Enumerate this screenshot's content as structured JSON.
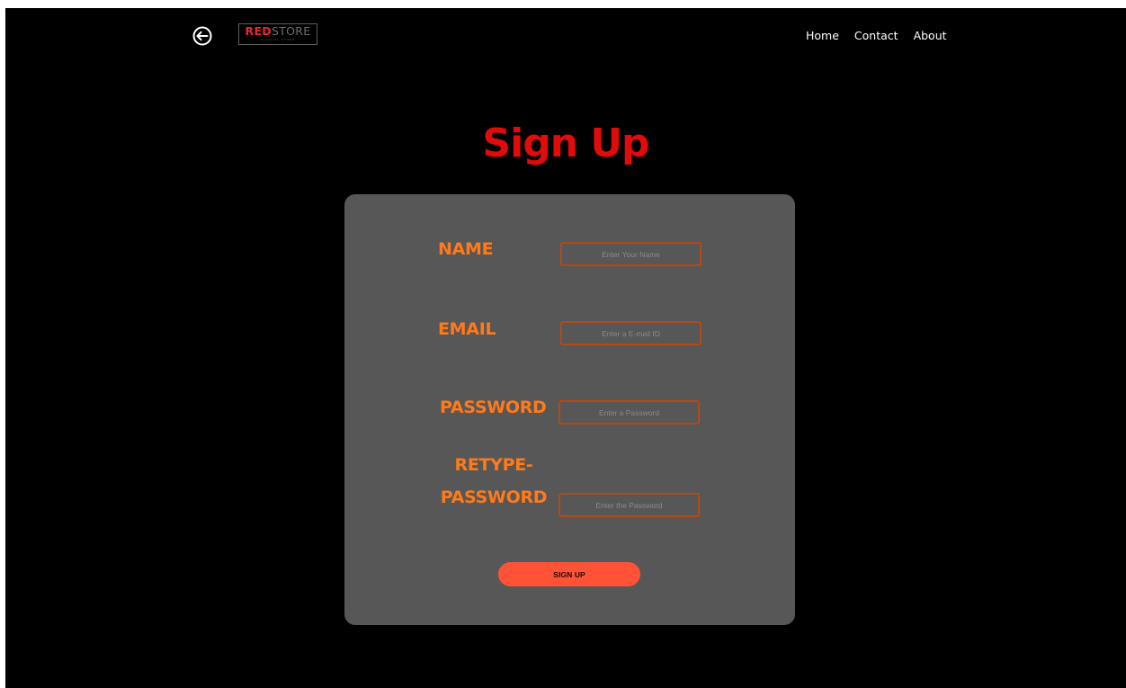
{
  "header": {
    "back_icon": "back-arrow-circle-icon",
    "logo": {
      "red_part": "RED",
      "gray_part": "STORE",
      "tagline": "OFFICIAL STORE"
    },
    "nav": {
      "home": "Home",
      "contact": "Contact",
      "about": "About"
    }
  },
  "page": {
    "title": "Sign Up"
  },
  "form": {
    "name": {
      "label": "NAME",
      "placeholder": "Enter Your Name",
      "value": ""
    },
    "email": {
      "label": "EMAIL",
      "placeholder": "Enter a E-mail ID",
      "value": ""
    },
    "password": {
      "label": "PASSWORD",
      "placeholder": "Enter a Password",
      "value": ""
    },
    "retype_password": {
      "label_line1": "RETYPE-",
      "label_line2": "PASSWORD",
      "placeholder": "Enter the Password",
      "value": ""
    },
    "submit_label": "SIGN UP"
  },
  "colors": {
    "background": "#000000",
    "title": "#e00b0b",
    "card": "#575757",
    "label": "#ff7a1a",
    "input_border": "#b24a17",
    "button": "#ff5236",
    "logo_red": "#e8282f"
  }
}
